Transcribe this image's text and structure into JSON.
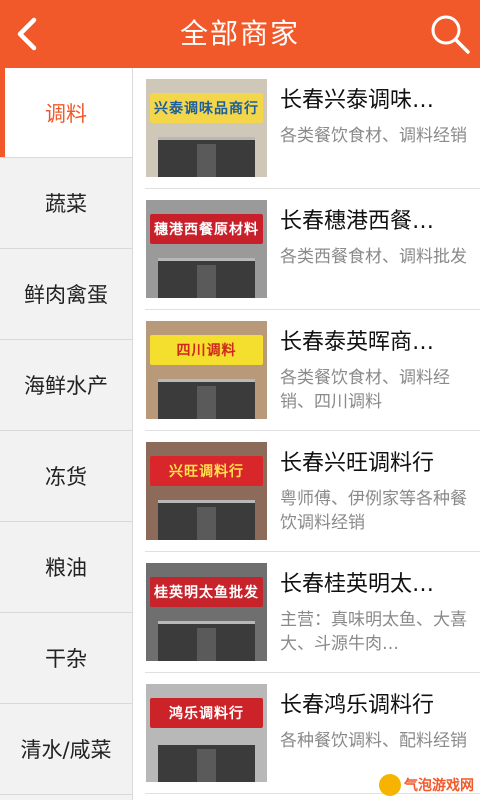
{
  "header": {
    "title": "全部商家",
    "back_icon": "chevron-left-icon",
    "search_icon": "search-icon"
  },
  "colors": {
    "accent": "#f1592a",
    "sidebar_bg": "#f2f2f2",
    "desc_text": "#8a8a8a"
  },
  "sidebar": {
    "active_index": 0,
    "items": [
      {
        "label": "调料"
      },
      {
        "label": "蔬菜"
      },
      {
        "label": "鲜肉禽蛋"
      },
      {
        "label": "海鲜水产"
      },
      {
        "label": "冻货"
      },
      {
        "label": "粮油"
      },
      {
        "label": "干杂"
      },
      {
        "label": "清水/咸菜"
      }
    ]
  },
  "shops": [
    {
      "name": "长春兴泰调味…",
      "desc": "各类餐饮食材、调料经销",
      "sign": "兴泰调味品商行",
      "sign_bg": "#f4d64a",
      "sign_fg": "#1d5e9e",
      "wall": "#cfc7b8"
    },
    {
      "name": "长春穗港西餐…",
      "desc": "各类西餐食材、调料批发",
      "sign": "穗港西餐原材料",
      "sign_bg": "#c8202b",
      "sign_fg": "#ffffff",
      "wall": "#9a9a9a"
    },
    {
      "name": "长春泰英晖商…",
      "desc": "各类餐饮食材、调料经销、四川调料",
      "sign": "四川调料",
      "sign_bg": "#f5df2e",
      "sign_fg": "#d0281f",
      "wall": "#b89a7a"
    },
    {
      "name": "长春兴旺调料行",
      "desc": "粤师傅、伊例家等各种餐饮调料经销",
      "sign": "兴旺调料行",
      "sign_bg": "#d9262b",
      "sign_fg": "#ffe14a",
      "wall": "#8c6b5a"
    },
    {
      "name": "长春桂英明太…",
      "desc": "主营：真味明太鱼、大喜大、斗源牛肉…",
      "sign": "桂英明太鱼批发",
      "sign_bg": "#c6232b",
      "sign_fg": "#ffffff",
      "wall": "#6f6f6f"
    },
    {
      "name": "长春鸿乐调料行",
      "desc": "各种餐饮调料、配料经销",
      "sign": "鸿乐调料行",
      "sign_bg": "#cc2329",
      "sign_fg": "#ffffff",
      "wall": "#b8b8b8"
    }
  ],
  "watermark": {
    "text": "气泡游戏网"
  }
}
